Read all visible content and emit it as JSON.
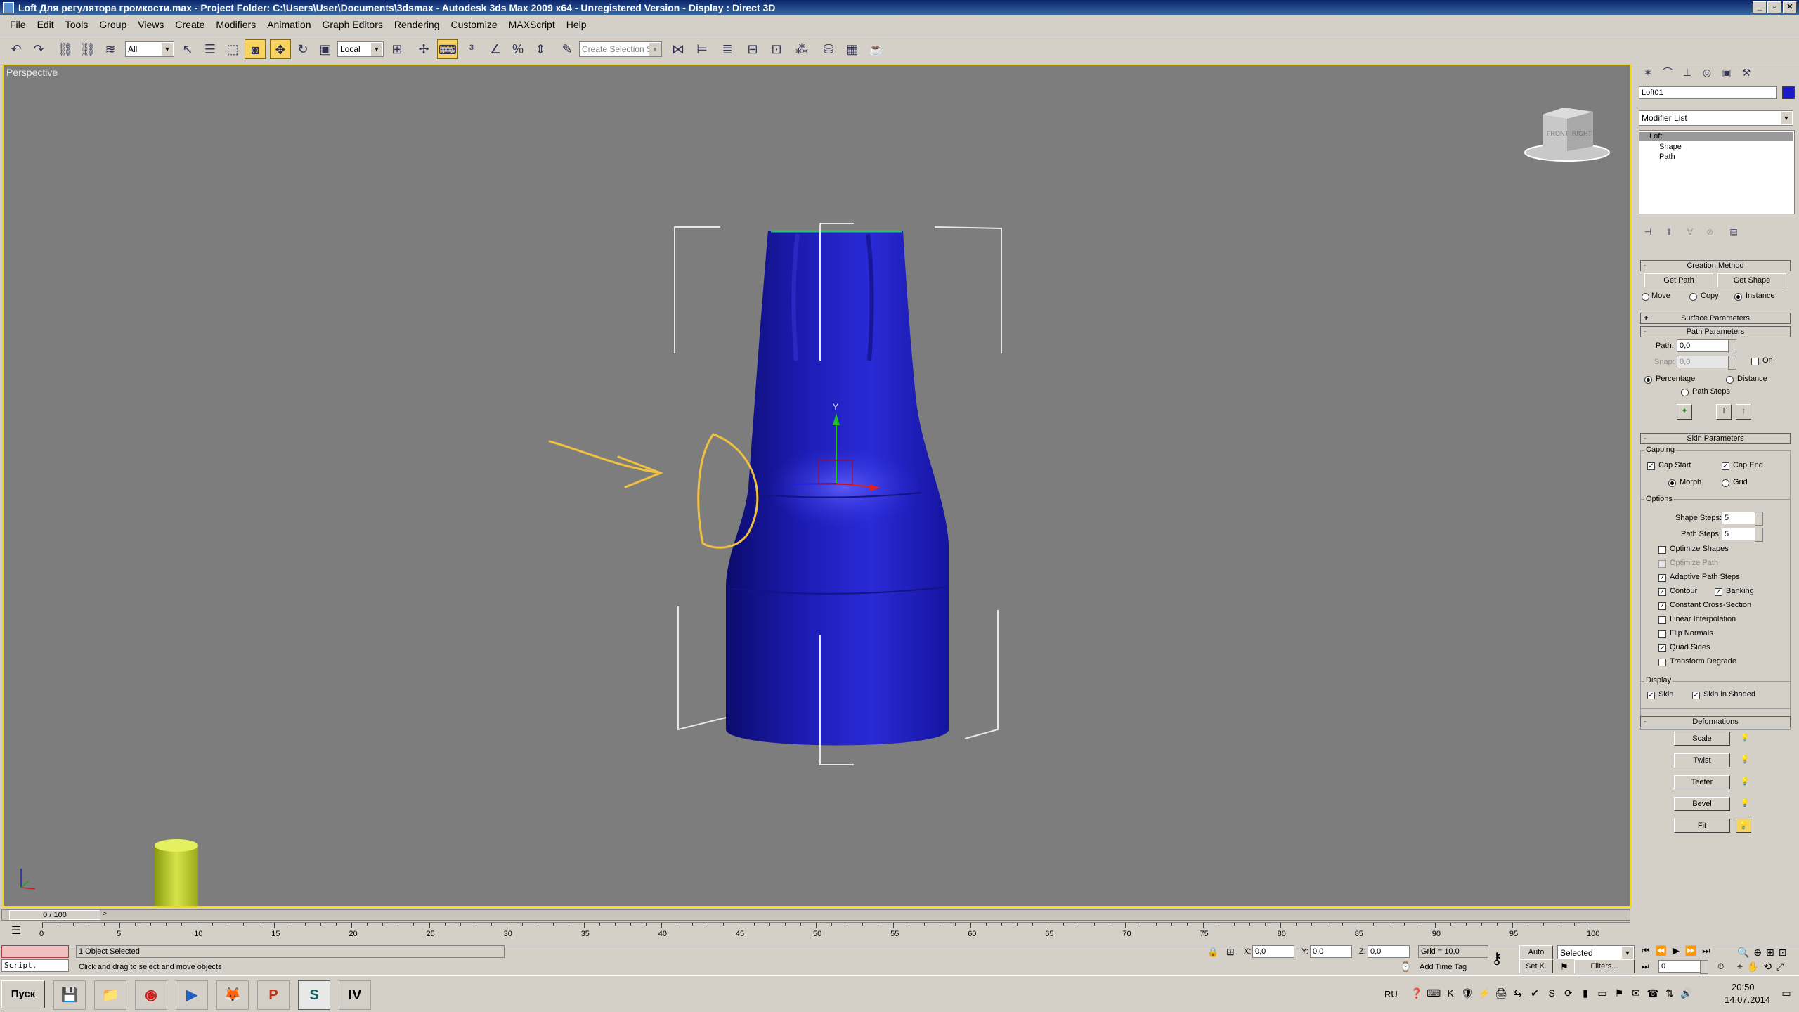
{
  "window": {
    "title": "Loft Для регулятора громкости.max    - Project Folder: C:\\Users\\User\\Documents\\3dsmax    - Autodesk 3ds Max  2009 x64    - Unregistered Version    - Display : Direct 3D",
    "minimize": "_",
    "maximize": "▫",
    "close": "✕"
  },
  "menu": [
    "File",
    "Edit",
    "Tools",
    "Group",
    "Views",
    "Create",
    "Modifiers",
    "Animation",
    "Graph Editors",
    "Rendering",
    "Customize",
    "MAXScript",
    "Help"
  ],
  "toolbar": {
    "filter_value": "All",
    "coord_value": "Local",
    "selection_set_placeholder": "Create Selection Se",
    "icons": [
      "undo-icon",
      "redo-icon",
      "link-icon",
      "unlink-icon",
      "bind-space-warp-icon",
      "select-object-icon",
      "select-by-name-icon",
      "region-select-icon",
      "window-crossing-icon",
      "move-icon",
      "rotate-icon",
      "scale-icon",
      "pivot-icon",
      "manipulate-icon",
      "keyboard-shortcut-icon",
      "snap-icon",
      "angle-snap-icon",
      "percent-snap-icon",
      "spinner-snap-icon",
      "edit-named-sel-icon",
      "mirror-icon",
      "align-icon",
      "layer-manager-icon",
      "curve-editor-icon",
      "schematic-view-icon",
      "material-editor-icon",
      "render-setup-icon",
      "rendered-frame-icon",
      "quick-render-icon"
    ]
  },
  "viewport": {
    "label": "Perspective",
    "viewcube": {
      "front": "FRONT",
      "right": "RIGHT"
    },
    "gizmo_axis_label": "Y"
  },
  "command_panel": {
    "object_name": "Loft01",
    "object_color": "#1a1ac8",
    "modifier_list": "Modifier List",
    "stack": [
      "Loft",
      "Shape",
      "Path"
    ],
    "creation_method": {
      "title": "Creation Method",
      "get_path": "Get Path",
      "get_shape": "Get Shape",
      "move": "Move",
      "copy": "Copy",
      "instance": "Instance"
    },
    "surface_parameters": "Surface Parameters",
    "path_parameters": {
      "title": "Path Parameters",
      "path_label": "Path:",
      "path_value": "0,0",
      "snap_label": "Snap:",
      "snap_value": "0,0",
      "on_label": "On",
      "percentage": "Percentage",
      "distance": "Distance",
      "path_steps": "Path Steps"
    },
    "skin_parameters": {
      "title": "Skin Parameters",
      "capping": "Capping",
      "cap_start": "Cap Start",
      "cap_end": "Cap End",
      "morph": "Morph",
      "grid": "Grid",
      "options": "Options",
      "shape_steps_label": "Shape Steps:",
      "shape_steps": "5",
      "path_steps_label": "Path Steps:",
      "path_steps": "5",
      "optimize_shapes": "Optimize Shapes",
      "optimize_path": "Optimize Path",
      "adaptive_path_steps": "Adaptive Path Steps",
      "contour": "Contour",
      "banking": "Banking",
      "constant_cross_section": "Constant Cross-Section",
      "linear_interpolation": "Linear Interpolation",
      "flip_normals": "Flip Normals",
      "quad_sides": "Quad Sides",
      "transform_degrade": "Transform Degrade",
      "display": "Display",
      "skin": "Skin",
      "skin_in_shaded": "Skin in Shaded"
    },
    "deformations": {
      "title": "Deformations",
      "scale": "Scale",
      "twist": "Twist",
      "teeter": "Teeter",
      "bevel": "Bevel",
      "fit": "Fit"
    }
  },
  "timeline": {
    "frame_label": "0 / 100",
    "ticks": [
      "0",
      "5",
      "10",
      "15",
      "20",
      "25",
      "30",
      "35",
      "40",
      "45",
      "50",
      "55",
      "60",
      "65",
      "70",
      "75",
      "80",
      "85",
      "90",
      "95",
      "100"
    ]
  },
  "status": {
    "script_label": "Script.",
    "selection": "1 Object Selected",
    "prompt": "Click and drag to select and move objects",
    "x_label": "X:",
    "x_value": "0,0",
    "y_label": "Y:",
    "y_value": "0,0",
    "z_label": "Z:",
    "z_value": "0,0",
    "grid": "Grid = 10,0",
    "add_time_tag": "Add Time Tag",
    "auto_key": "Auto",
    "set_key": "Set K.",
    "key_filter": "Selected",
    "filters": "Filters...",
    "frame_value": "0"
  },
  "taskbar": {
    "start": "Пуск",
    "lang": "RU",
    "time": "20:50",
    "date": "14.07.2014"
  }
}
